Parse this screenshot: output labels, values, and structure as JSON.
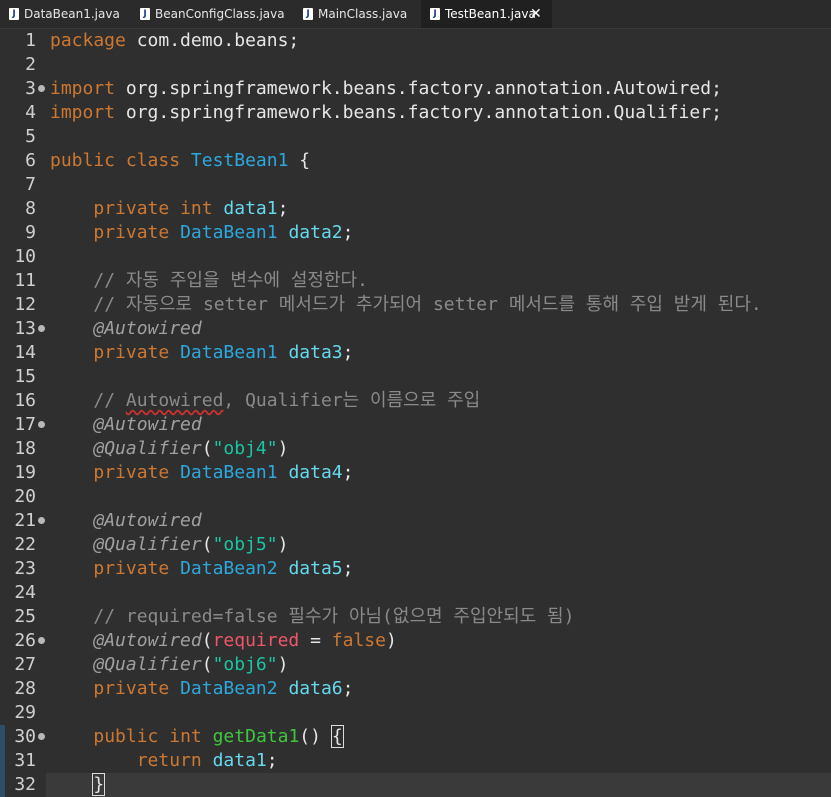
{
  "tabs": [
    {
      "label": "DataBean1.java",
      "icon": "java-file-icon",
      "active": false
    },
    {
      "label": "BeanConfigClass.java",
      "icon": "java-file-icon",
      "active": false
    },
    {
      "label": "MainClass.java",
      "icon": "java-file-icon",
      "active": false
    },
    {
      "label": "TestBean1.java",
      "icon": "java-file-icon",
      "active": true,
      "closable": true
    }
  ],
  "tab_icon_glyph": "J",
  "tab_close_glyph": "✕",
  "colors": {
    "editor_background": "#2f2f2f",
    "keyword": "#cc7832",
    "type": "#2ea7dd",
    "field": "#66d9ef",
    "annotation": "#a0a0a0",
    "comment": "#8a8a8a",
    "string": "#17c6a3",
    "parameter": "#f0566b",
    "method": "#3ec73e"
  },
  "editor": {
    "line_numbers": [
      "1",
      "2",
      "3",
      "4",
      "5",
      "6",
      "7",
      "8",
      "9",
      "10",
      "11",
      "12",
      "13",
      "14",
      "15",
      "16",
      "17",
      "18",
      "19",
      "20",
      "21",
      "22",
      "23",
      "24",
      "25",
      "26",
      "27",
      "28",
      "29",
      "30",
      "31",
      "32"
    ],
    "fold_markers_on_lines": [
      3,
      13,
      17,
      21,
      26,
      30
    ],
    "current_line": 32,
    "lines": [
      "package com.demo.beans;",
      "",
      "import org.springframework.beans.factory.annotation.Autowired;",
      "import org.springframework.beans.factory.annotation.Qualifier;",
      "",
      "public class TestBean1 {",
      "",
      "    private int data1;",
      "    private DataBean1 data2;",
      "",
      "    // 자동 주입을 변수에 설정한다.",
      "    // 자동으로 setter 메서드가 추가되어 setter 메서드를 통해 주입 받게 된다.",
      "    @Autowired",
      "    private DataBean1 data3;",
      "",
      "    // Autowired, Qualifier는 이름으로 주입",
      "    @Autowired",
      "    @Qualifier(\"obj4\")",
      "    private DataBean1 data4;",
      "",
      "    @Autowired",
      "    @Qualifier(\"obj5\")",
      "    private DataBean2 data5;",
      "",
      "    // required=false 필수가 아님(없으면 주입안되도 됨)",
      "    @Autowired(required = false)",
      "    @Qualifier(\"obj6\")",
      "    private DataBean2 data6;",
      "",
      "    public int getData1() {",
      "        return data1;",
      "    }"
    ]
  }
}
